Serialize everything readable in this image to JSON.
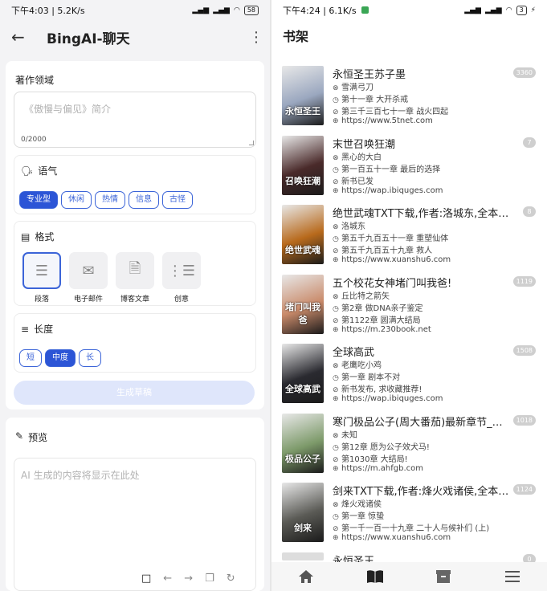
{
  "left": {
    "status": {
      "time_speed": "下午4:03 | 5.2K/s",
      "signal1": "HD",
      "signal2": "HD",
      "battery": "58"
    },
    "title": "BingAI-聊天",
    "field_section": "著作领域",
    "field_placeholder": "《傲慢与偏见》简介",
    "char_count": "0/2000",
    "tone": {
      "label": "语气",
      "options": [
        "专业型",
        "休闲",
        "热情",
        "信息",
        "古怪"
      ],
      "selected": "专业型"
    },
    "format": {
      "label": "格式",
      "options": [
        "段落",
        "电子邮件",
        "博客文章",
        "创意"
      ],
      "selected": "段落"
    },
    "length": {
      "label": "长度",
      "options": [
        "短",
        "中度",
        "长"
      ],
      "selected": "中度"
    },
    "generate_button": "生成草稿",
    "preview": {
      "label": "预览",
      "placeholder": "AI 生成的内容将显示在此处"
    },
    "accent": "#2c55d6"
  },
  "right": {
    "status": {
      "time_speed": "下午4:24 | 6.1K/s",
      "battery": "3"
    },
    "title": "书架",
    "books": [
      {
        "title": "永恒圣王苏子墨",
        "author": "雪满弓刀",
        "read": "第十一章 大开杀戒",
        "latest": "第三千三百七十一章 战火四起",
        "url": "https://www.5tnet.com",
        "badge": "3360",
        "cover_color": "#9aa7bf",
        "cover_text": "永恒圣王"
      },
      {
        "title": "末世召唤狂潮",
        "author": "黑心的大白",
        "read": "第一百五十一章 最后的选择",
        "latest": "新书已发",
        "url": "https://wap.ibiquges.com",
        "badge": "7",
        "cover_color": "#4a2a2a",
        "cover_text": "召唤狂潮"
      },
      {
        "title": "绝世武魂TXT下载,作者:洛城东,全本小说...",
        "author": "洛城东",
        "read": "第五千九百五十一章 重塑仙体",
        "latest": "第五千九百五十九章 救人",
        "url": "https://www.xuanshu6.com",
        "badge": "8",
        "cover_color": "#b86a1c",
        "cover_text": "绝世武魂"
      },
      {
        "title": "五个校花女神堵门叫我爸!",
        "author": "丘比特之箭矢",
        "read": "第2章 做DNA亲子鉴定",
        "latest": "第1122章 圆满大结局",
        "url": "https://m.230book.net",
        "badge": "1119",
        "cover_color": "#c98a6a",
        "cover_text": "堵门叫我爸"
      },
      {
        "title": "全球高武",
        "author": "老鹰吃小鸡",
        "read": "第一章 剧本不对",
        "latest": "新书发布, 求收藏推荐!",
        "url": "https://wap.ibiquges.com",
        "badge": "1508",
        "cover_color": "#2a2a30",
        "cover_text": "全球高武"
      },
      {
        "title": "寒门极品公子(周大番茄)最新章节_寒门极...",
        "author": "未知",
        "read": "第12章 愿为公子效犬马!",
        "latest": "第1030章 大结局!",
        "url": "https://m.ahfgb.com",
        "badge": "1018",
        "cover_color": "#7d9a6a",
        "cover_text": "极品公子"
      },
      {
        "title": "剑来TXT下载,作者:烽火戏诸侯,全本小说...",
        "author": "烽火戏诸侯",
        "read": "第一章 惊蛰",
        "latest": "第一千一百一十九章 二十人与候补们 (上)",
        "url": "https://www.xuanshu6.com",
        "badge": "1124",
        "cover_color": "#5a5a55",
        "cover_text": "剑来"
      },
      {
        "title": "永恒圣王",
        "badge": "0"
      }
    ]
  }
}
